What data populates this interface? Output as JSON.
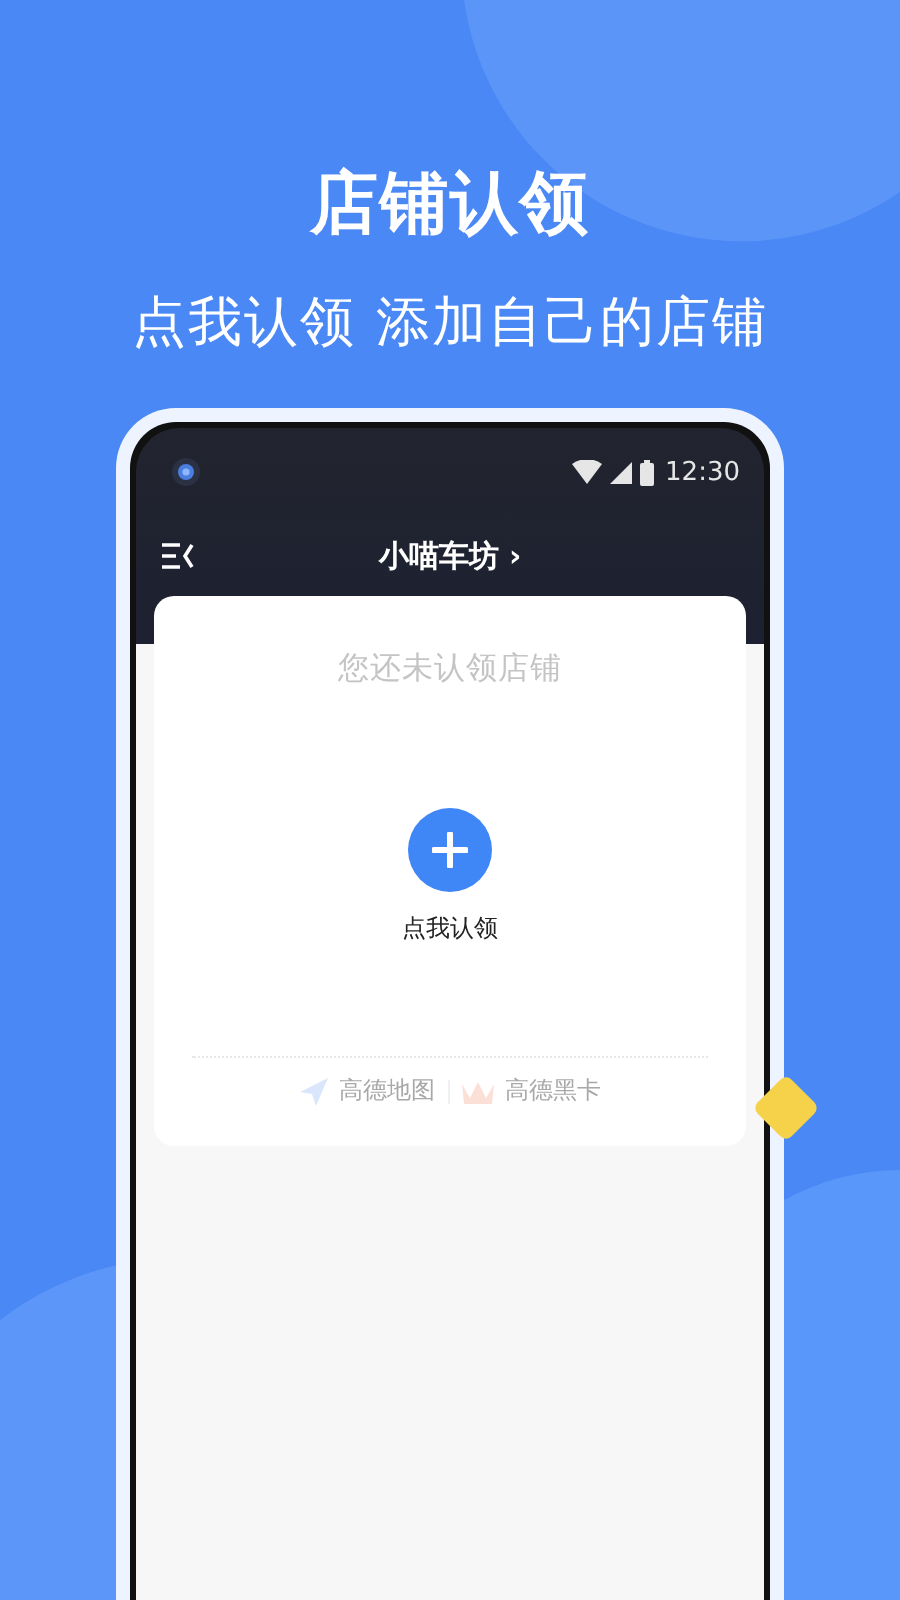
{
  "headline": {
    "title": "店铺认领",
    "subtitle": "点我认领 添加自己的店铺"
  },
  "status_bar": {
    "time": "12:30"
  },
  "app_bar": {
    "title": "小喵车坊",
    "chevron": "›"
  },
  "card": {
    "message": "您还未认领店铺",
    "action_label": "点我认领",
    "partners": [
      "高德地图",
      "高德黑卡"
    ]
  }
}
